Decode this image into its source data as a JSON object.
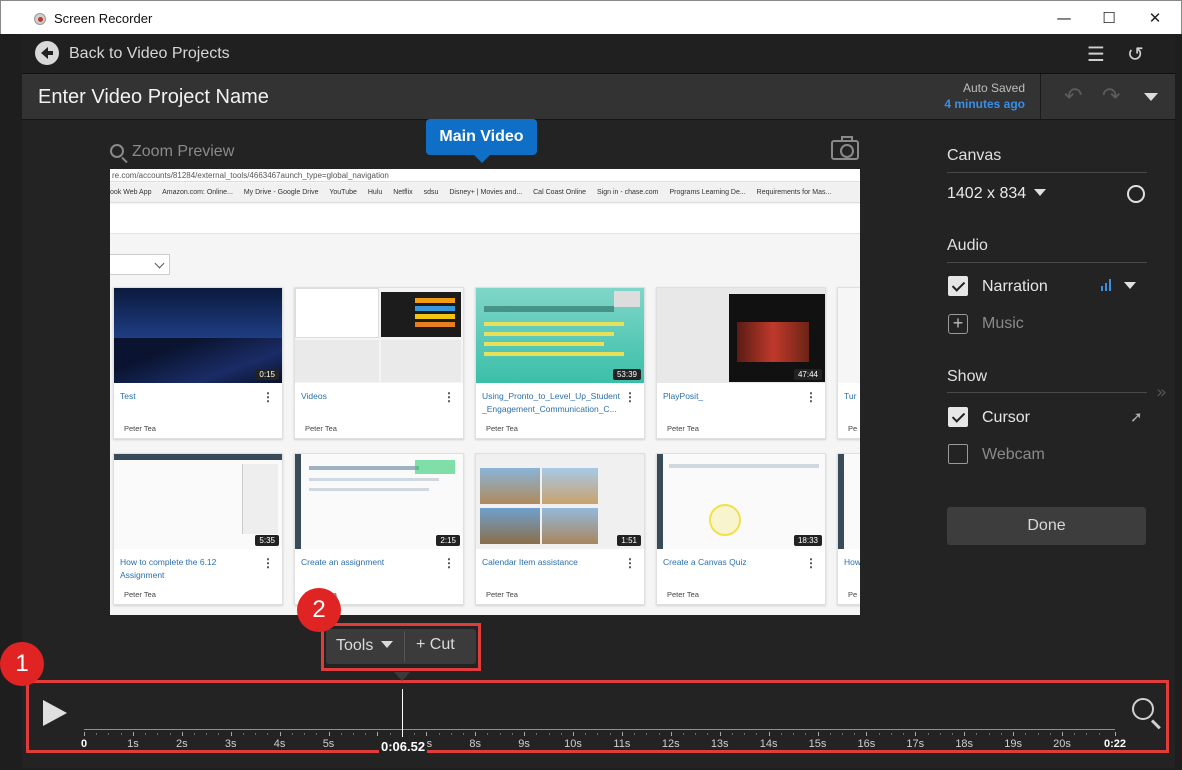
{
  "window": {
    "title": "Screen Recorder",
    "minimize_glyph": "—",
    "maximize_glyph": "☐",
    "close_glyph": "✕"
  },
  "nav": {
    "back_label": "Back to Video Projects"
  },
  "header": {
    "project_name": "Enter Video Project Name",
    "auto_saved_label": "Auto Saved",
    "auto_saved_time": "4 minutes ago"
  },
  "preview": {
    "zoom_label": "Zoom Preview",
    "main_video_label": "Main Video",
    "address_bar": "re.com/accounts/81284/external_tools/4663467aunch_type=global_navigation",
    "bookmarks": [
      "ook Web App",
      "Amazon.com: Online...",
      "My Drive - Google Drive",
      "YouTube",
      "Hulu",
      "Netflix",
      "sdsu",
      "Disney+ | Movies and...",
      "Cal Coast Online",
      "Sign in - chase.com",
      "Programs Learning De...",
      "Requirements for Mas..."
    ],
    "cards": [
      {
        "title": "Test",
        "duration": "0:15",
        "owner": "Peter Tea"
      },
      {
        "title": "Videos",
        "duration": "",
        "owner": "Peter Tea"
      },
      {
        "title": "Using_Pronto_to_Level_Up_Student_Engagement_Communication_C...",
        "duration": "53:39",
        "owner": "Peter Tea"
      },
      {
        "title": "PlayPosit_",
        "duration": "47:44",
        "owner": "Peter Tea"
      },
      {
        "title": "Tur",
        "duration": "",
        "owner": "Pe"
      },
      {
        "title": "How to complete the 6.12 Assignment",
        "duration": "5:35",
        "owner": "Peter Tea"
      },
      {
        "title": "Create an assignment",
        "duration": "2:15",
        "owner": "Peter Tea"
      },
      {
        "title": "Calendar Item assistance",
        "duration": "1:51",
        "owner": "Peter Tea"
      },
      {
        "title": "Create a Canvas Quiz",
        "duration": "18:33",
        "owner": "Peter Tea"
      },
      {
        "title": "How",
        "duration": "",
        "owner": "Pe"
      }
    ],
    "card_kebab": "⋮"
  },
  "side_panel": {
    "canvas_title": "Canvas",
    "canvas_size": "1402 x 834",
    "audio_title": "Audio",
    "narration_label": "Narration",
    "narration_checked": true,
    "music_label": "Music",
    "show_title": "Show",
    "cursor_label": "Cursor",
    "cursor_checked": true,
    "webcam_label": "Webcam",
    "webcam_checked": false,
    "done_label": "Done"
  },
  "tools": {
    "tools_label": "Tools",
    "cut_label": "+ Cut"
  },
  "callouts": [
    "1",
    "2"
  ],
  "timeline": {
    "current_time": "0:06.52",
    "ticks": [
      "0",
      "1s",
      "2s",
      "3s",
      "4s",
      "5s",
      "6s",
      "7s",
      "8s",
      "9s",
      "10s",
      "11s",
      "12s",
      "13s",
      "14s",
      "15s",
      "16s",
      "17s",
      "18s",
      "19s",
      "20s",
      "0:22"
    ]
  },
  "colors": {
    "accent_blue": "#0f6fc6",
    "autosave_blue": "#3a8ee6",
    "callout_red": "#e02424",
    "highlight_red": "#e03c3c"
  }
}
